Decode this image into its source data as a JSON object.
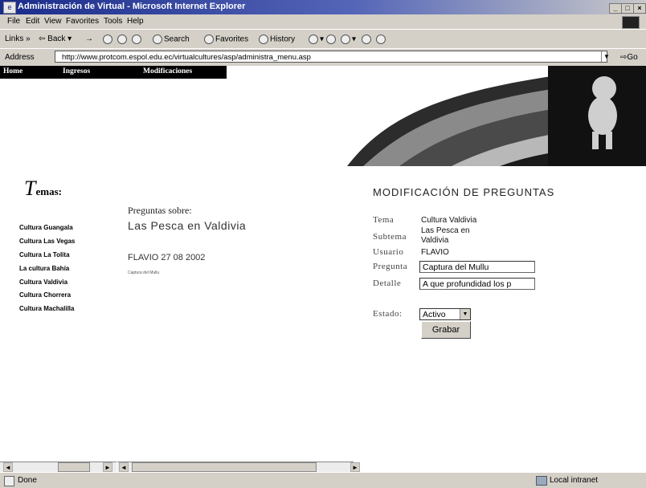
{
  "window": {
    "title": "Administración de Virtual - Microsoft Internet Explorer",
    "controls": [
      "_",
      "□",
      "×"
    ]
  },
  "menu": [
    "File",
    "Edit",
    "View",
    "Favorites",
    "Tools",
    "Help"
  ],
  "toolbar": {
    "links": "Links »",
    "back": "Back",
    "forward": "→",
    "search": "Search",
    "favorites": "Favorites",
    "history": "History"
  },
  "address": {
    "label": "Address",
    "url": "http://www.protcom.espol.edu.ec/virtualcultures/asp/administra_menu.asp",
    "go": "Go"
  },
  "nav": [
    "Home",
    "Ingresos",
    "Modificaciones"
  ],
  "temas": {
    "title_initial": "T",
    "title_rest": "emas:",
    "items": [
      "Cultura Guangala",
      "Cultura Las Vegas",
      "Cultura La Tolita",
      "La cultura Bahía",
      "Cultura Valdivia",
      "Cultura Chorrera",
      "Cultura Machalilla"
    ]
  },
  "preguntas": {
    "heading": "Preguntas sobre:",
    "subject": "Las Pesca en Valdivia",
    "user_date": "FLAVIO 27 08 2002",
    "item": "Captura del Mullu"
  },
  "form": {
    "title": "MODIFICACIÓN DE PREGUNTAS",
    "tema_label": "Tema",
    "tema_value": "Cultura Valdivia",
    "subtema_label": "Subtema",
    "subtema_value_1": "Las Pesca en",
    "subtema_value_2": "Valdivia",
    "usuario_label": "Usuario",
    "usuario_value": "FLAVIO",
    "pregunta_label": "Pregunta",
    "pregunta_value": "Captura del Mullu",
    "detalle_label": "Detalle",
    "detalle_value": "A que profundidad los p",
    "estado_label": "Estado:",
    "estado_value": "Activo",
    "save_button": "Grabar"
  },
  "status": {
    "text": "Done",
    "zone": "Local intranet"
  }
}
